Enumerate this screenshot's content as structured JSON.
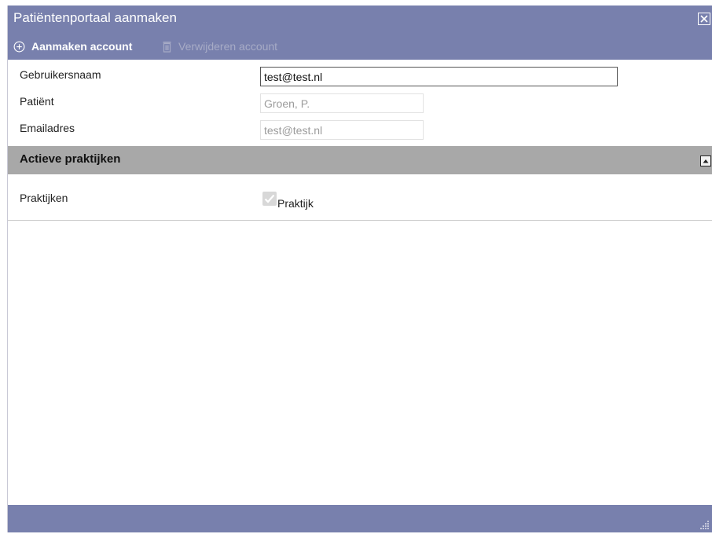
{
  "window": {
    "title": "Patiëntenportaal aanmaken",
    "close_icon": "close-icon"
  },
  "toolbar": {
    "add_label": "Aanmaken account",
    "add_icon": "plus-circle-icon",
    "delete_label": "Verwijderen account",
    "delete_icon": "trash-icon",
    "delete_enabled": false
  },
  "form": {
    "username_label": "Gebruikersnaam",
    "username_value": "test@test.nl",
    "patient_label": "Patiënt",
    "patient_value": "Groen, P.",
    "email_label": "Emailadres",
    "email_value": "test@test.nl"
  },
  "practices": {
    "section_title": "Actieve praktijken",
    "collapse_icon": "collapse-icon",
    "label": "Praktijken",
    "checkbox_label": "Praktijk",
    "checked": true,
    "enabled": false
  },
  "colors": {
    "titlebar": "#7880ad",
    "section_header": "#a8a8a8"
  }
}
